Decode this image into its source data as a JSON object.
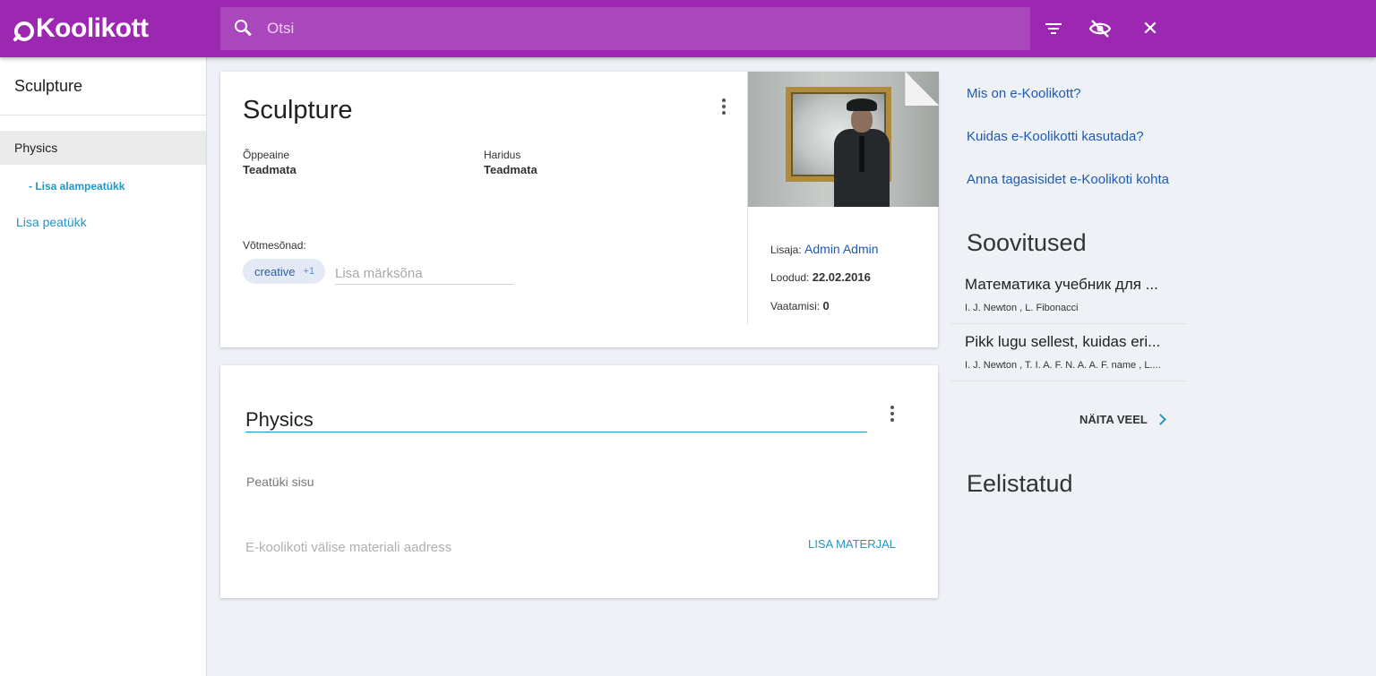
{
  "header": {
    "logo_text": "Koolikott",
    "search_placeholder": "Otsi",
    "brand_color": "#9c27b0",
    "icons": [
      "search-icon",
      "filter-icon",
      "visibility-off-icon",
      "close-icon"
    ]
  },
  "sidebar": {
    "title": "Sculpture",
    "chapters": [
      {
        "label": "Physics",
        "selected": true
      }
    ],
    "add_subchapter": "- Lisa alampeatükk",
    "add_chapter": "Lisa peatükk"
  },
  "material": {
    "title": "Sculpture",
    "subject_label": "Õppeaine",
    "subject_value": "Teadmata",
    "education_label": "Haridus",
    "education_value": "Teadmata",
    "keywords_label": "Võtmesõnad:",
    "keyword_chip": "creative",
    "keyword_more": "+1",
    "keyword_placeholder": "Lisa märksõna",
    "added_by_label": "Lisaja:",
    "added_by_value": "Admin Admin",
    "created_label": "Loodud:",
    "created_value": "22.02.2016",
    "views_label": "Vaatamisi:",
    "views_value": "0"
  },
  "chapter": {
    "title_value": "Physics",
    "content_placeholder": "Peatüki sisu",
    "url_placeholder": "E-koolikoti välise materiali aadress",
    "add_material": "LISA MATERJAL"
  },
  "right": {
    "links": [
      "Mis on e-Koolikott?",
      "Kuidas e-Koolikotti kasutada?",
      "Anna tagasisidet e-Koolikoti kohta"
    ],
    "recommendations_title": "Soovitused",
    "recommendations": [
      {
        "title": "Математика учебник для ...",
        "authors": "I. J. Newton , L. Fibonacci"
      },
      {
        "title": "Pikk lugu sellest, kuidas eri...",
        "authors": "I. J. Newton , T. I. A. F. N. A. A. F. name , L...."
      }
    ],
    "show_more": "NÄITA VEEL",
    "favorites_title": "Eelistatud"
  }
}
